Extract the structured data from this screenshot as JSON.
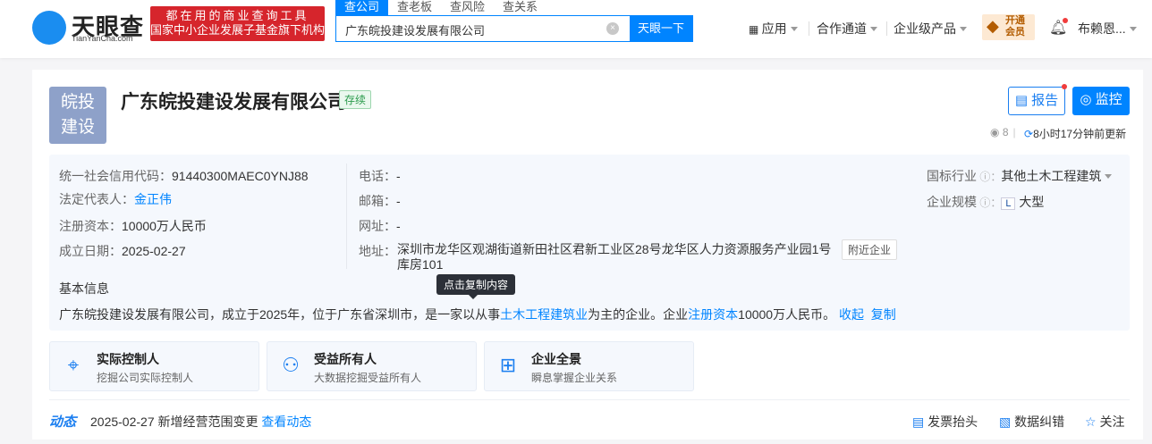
{
  "header": {
    "logo_text": "天眼查",
    "logo_sub": "TianYanCha.com",
    "slogan_1": "都在用的商业查询工具",
    "slogan_2": "国家中小企业发展子基金旗下机构",
    "search_tabs": [
      "查公司",
      "查老板",
      "查风险",
      "查关系"
    ],
    "search_value": "广东皖投建设发展有限公司",
    "search_button": "天眼一下",
    "nav": [
      "应用",
      "合作通道",
      "企业级产品"
    ],
    "vip_1": "开通",
    "vip_2": "会员",
    "user": "布赖恩..."
  },
  "company": {
    "logo_1": "皖投",
    "logo_2": "建设",
    "name": "广东皖投建设发展有限公司",
    "status": "存续",
    "report": "报告",
    "monitor": "监控",
    "views": "8",
    "updated": "8小时17分钟前更新"
  },
  "info": {
    "credit_label": "统一社会信用代码：",
    "credit": "91440300MAEC0YNJ88",
    "legal_label": "法定代表人：",
    "legal": "金正伟",
    "capital_label": "注册资本：",
    "capital": "10000万人民币",
    "date_label": "成立日期：",
    "date": "2025-02-27",
    "phone_label": "电话：",
    "phone": "-",
    "email_label": "邮箱：",
    "email": "-",
    "web_label": "网址：",
    "web": "-",
    "addr_label": "地址：",
    "addr": "深圳市龙华区观湖街道新田社区君新工业区28号龙华区人力资源服务产业园1号库房101",
    "nearby": "附近企业",
    "industry_label": "国标行业",
    "industry": "其他土木工程建筑",
    "scale_label": "企业规模",
    "scale_badge": "L",
    "scale": "大型",
    "basic_title": "基本信息",
    "tooltip": "点击复制内容",
    "desc_1": "广东皖投建设发展有限公司，成立于2025年，位于广东省深圳市，是一家以从事",
    "desc_link1": "土木工程建筑业",
    "desc_2": "为主的企业。企业",
    "desc_link2": "注册资本",
    "desc_3": "10000万人民币。",
    "collapse": "收起",
    "copy": "复制"
  },
  "quick": [
    {
      "title": "实际控制人",
      "sub": "挖掘公司实际控制人"
    },
    {
      "title": "受益所有人",
      "sub": "大数据挖掘受益所有人"
    },
    {
      "title": "企业全景",
      "sub": "瞬息掌握企业关系"
    }
  ],
  "dynamic": {
    "label": "动态",
    "text": "2025-02-27 新增经营范围变更",
    "link": "查看动态",
    "invoice": "发票抬头",
    "correct": "数据纠错",
    "follow": "关注"
  }
}
